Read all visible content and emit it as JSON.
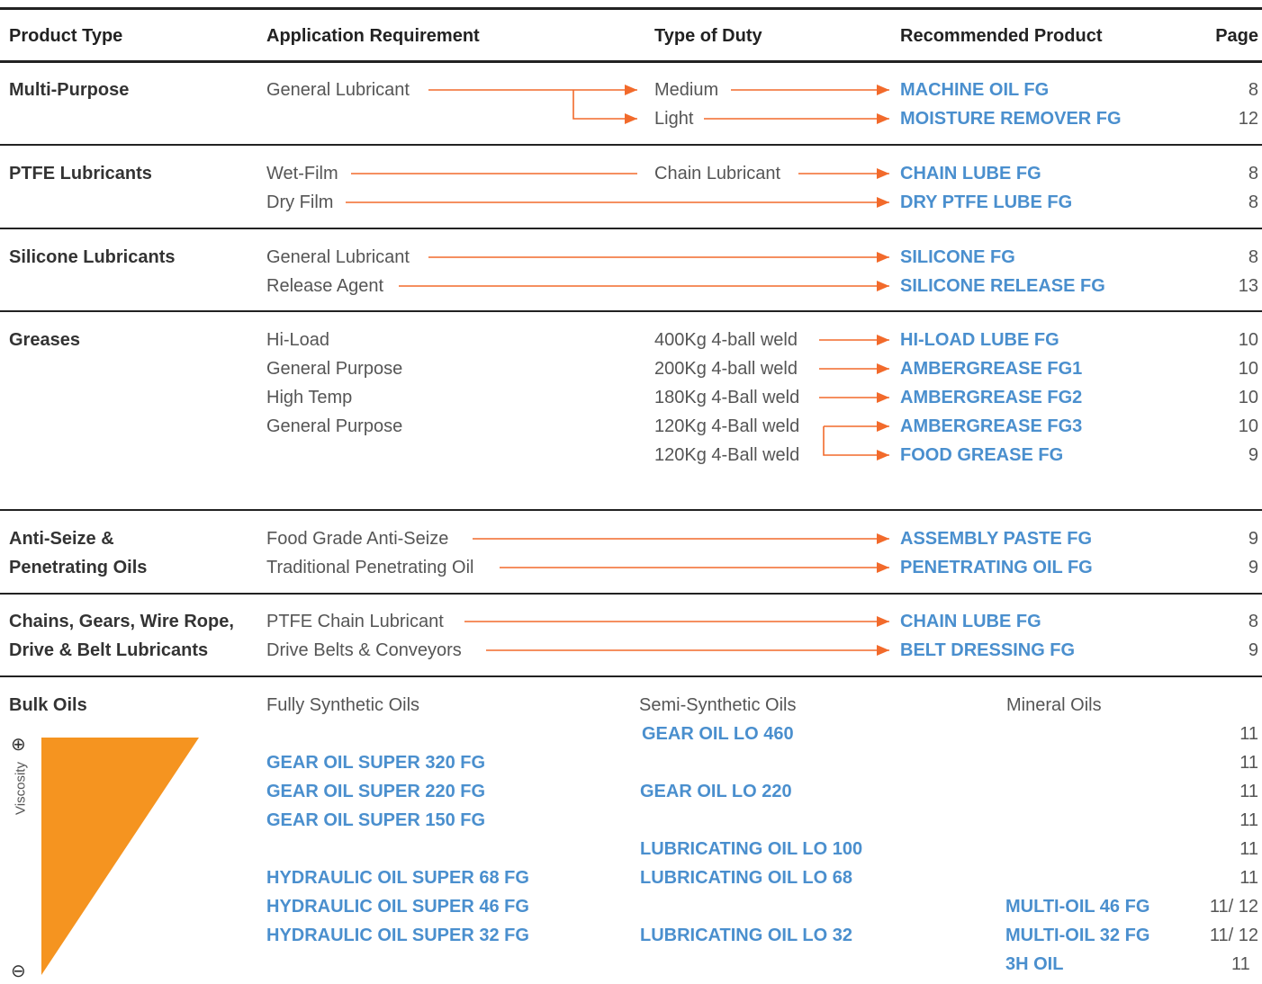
{
  "headers": {
    "product_type": "Product Type",
    "application_requirement": "Application Requirement",
    "type_of_duty": "Type of Duty",
    "recommended_product": "Recommended Product",
    "page": "Page"
  },
  "sections": {
    "multi_purpose": {
      "type": "Multi-Purpose",
      "rows": [
        {
          "application": "General Lubricant",
          "duty": "Medium",
          "product": "MACHINE OIL FG",
          "page": "8"
        },
        {
          "application": "",
          "duty": "Light",
          "product": "MOISTURE REMOVER FG",
          "page": "12"
        }
      ]
    },
    "ptfe": {
      "type": "PTFE Lubricants",
      "rows": [
        {
          "application": "Wet-Film",
          "duty": "Chain Lubricant",
          "product": "CHAIN LUBE FG",
          "page": "8"
        },
        {
          "application": "Dry Film",
          "duty": "",
          "product": "DRY PTFE LUBE FG",
          "page": "8"
        }
      ]
    },
    "silicone": {
      "type": "Silicone Lubricants",
      "rows": [
        {
          "application": "General Lubricant",
          "duty": "",
          "product": "SILICONE FG",
          "page": "8"
        },
        {
          "application": "Release Agent",
          "duty": "",
          "product": "SILICONE RELEASE FG",
          "page": "13"
        }
      ]
    },
    "greases": {
      "type": "Greases",
      "rows": [
        {
          "application": "Hi-Load",
          "duty": "400Kg 4-ball weld",
          "product": "HI-LOAD LUBE FG",
          "page": "10"
        },
        {
          "application": "General Purpose",
          "duty": "200Kg 4-ball weld",
          "product": "AMBERGREASE FG1",
          "page": "10"
        },
        {
          "application": "High Temp",
          "duty": "180Kg 4-Ball weld",
          "product": "AMBERGREASE FG2",
          "page": "10"
        },
        {
          "application": "General Purpose",
          "duty": "120Kg 4-Ball weld",
          "product": "AMBERGREASE FG3",
          "page": "10"
        },
        {
          "application": "",
          "duty": "120Kg 4-Ball weld",
          "product": "FOOD GREASE FG",
          "page": "9"
        }
      ]
    },
    "anti_seize": {
      "type_line1": "Anti-Seize &",
      "type_line2": "Penetrating Oils",
      "rows": [
        {
          "application": "Food Grade Anti-Seize",
          "product": "ASSEMBLY PASTE FG",
          "page": "9"
        },
        {
          "application": "Traditional Penetrating Oil",
          "product": "PENETRATING OIL FG",
          "page": "9"
        }
      ]
    },
    "chains": {
      "type_line1": "Chains, Gears, Wire Rope,",
      "type_line2": "Drive & Belt Lubricants",
      "rows": [
        {
          "application": "PTFE Chain Lubricant",
          "product": "CHAIN LUBE FG",
          "page": "8"
        },
        {
          "application": "Drive Belts & Conveyors",
          "product": "BELT DRESSING FG",
          "page": "9"
        }
      ]
    },
    "bulk_oils": {
      "type": "Bulk Oils",
      "col_fully_synthetic": "Fully Synthetic Oils",
      "col_semi_synthetic": "Semi-Synthetic Oils",
      "col_mineral": "Mineral Oils",
      "viscosity_label": "Viscosity",
      "plus_symbol": "⊕",
      "minus_symbol": "⊖",
      "rows": [
        {
          "fully": "",
          "semi": "GEAR OIL LO 460",
          "mineral": "",
          "page": "11"
        },
        {
          "fully": "GEAR OIL SUPER 320 FG",
          "semi": "",
          "mineral": "",
          "page": "11"
        },
        {
          "fully": "GEAR OIL SUPER 220 FG",
          "semi": "GEAR OIL LO 220",
          "mineral": "",
          "page": "11"
        },
        {
          "fully": "GEAR OIL SUPER 150 FG",
          "semi": "",
          "mineral": "",
          "page": "11"
        },
        {
          "fully": "",
          "semi": "LUBRICATING OIL LO 100",
          "mineral": "",
          "page": "11"
        },
        {
          "fully": "HYDRAULIC OIL SUPER 68 FG",
          "semi": "LUBRICATING OIL LO 68",
          "mineral": "",
          "page": "11"
        },
        {
          "fully": "HYDRAULIC OIL SUPER 46 FG",
          "semi": "",
          "mineral": "MULTI-OIL 46 FG",
          "page": "11/ 12"
        },
        {
          "fully": "HYDRAULIC OIL SUPER 32 FG",
          "semi": "LUBRICATING OIL LO 32",
          "mineral": "MULTI-OIL 32 FG",
          "page": "11/ 12"
        },
        {
          "fully": "",
          "semi": "",
          "mineral": "3H OIL",
          "page": "11"
        }
      ]
    }
  },
  "colors": {
    "arrow": "#f26a2b",
    "product": "#4a8fce",
    "triangle": "#f59420",
    "rule": "#222222"
  }
}
